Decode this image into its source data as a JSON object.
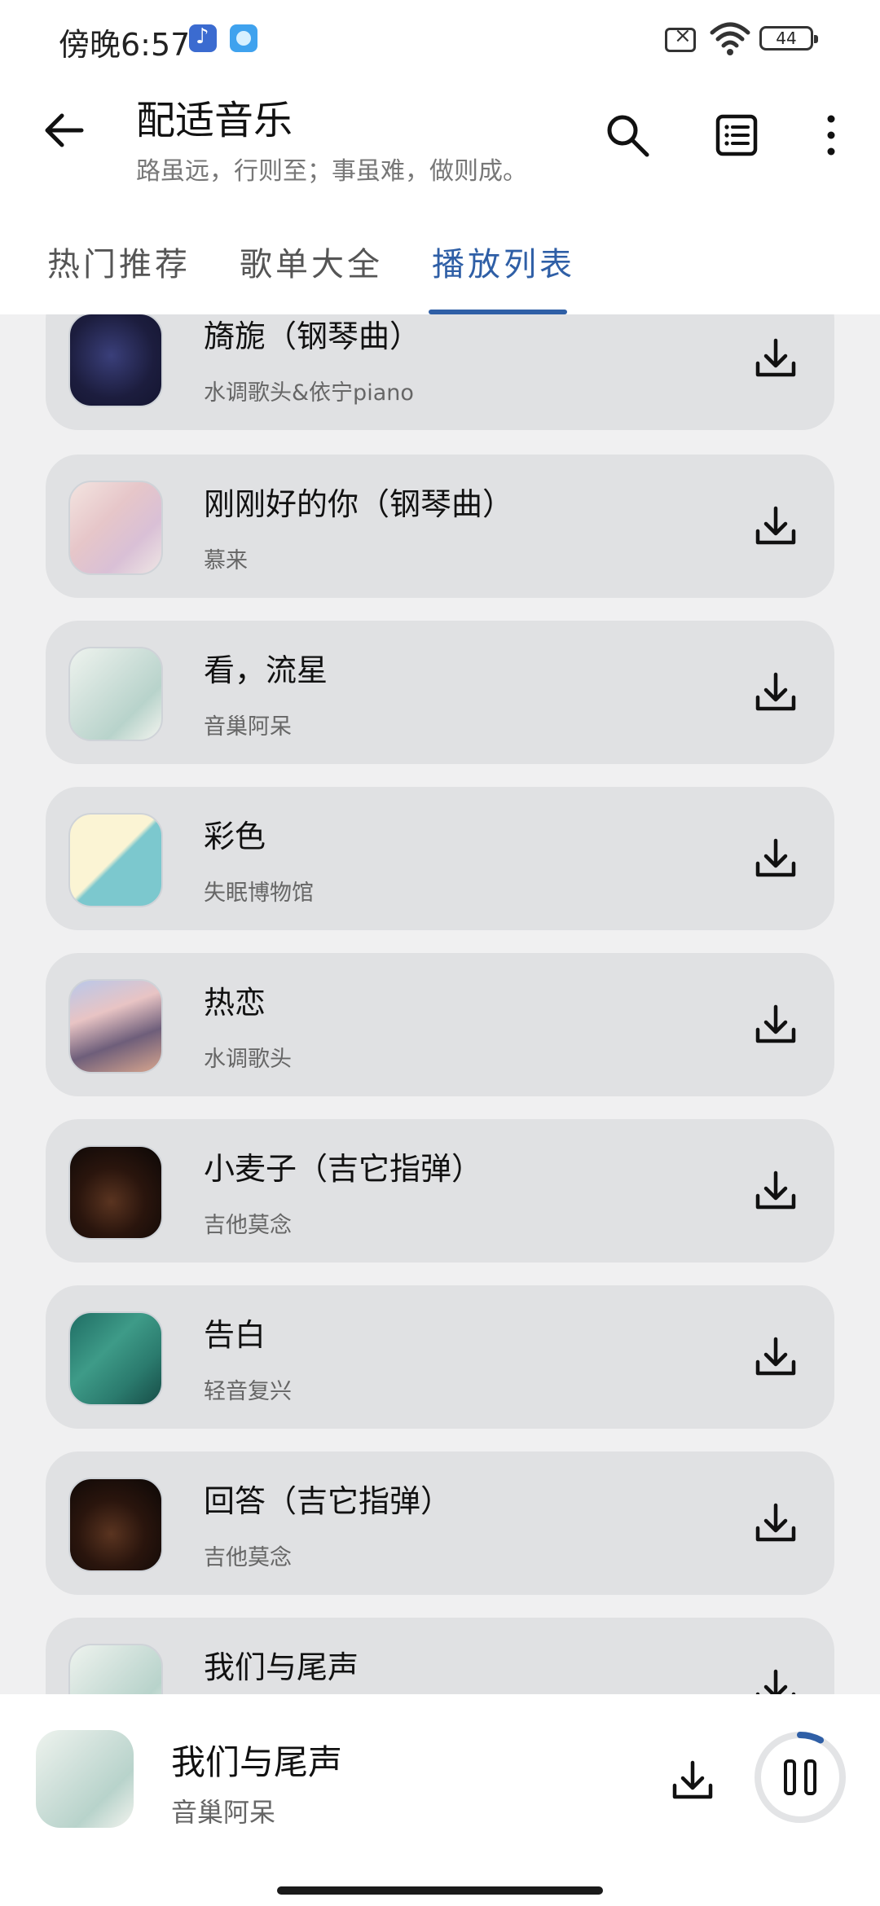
{
  "status_bar": {
    "time": "傍晚6:57",
    "battery": "44",
    "icons": [
      "music-app-icon",
      "chat-app-icon",
      "no-sim-icon",
      "wifi-icon",
      "battery-icon"
    ]
  },
  "header": {
    "title": "配适音乐",
    "subtitle": "路虽远，行则至；事虽难，做则成。",
    "icons": [
      "back-arrow-icon",
      "search-icon",
      "playlist-icon",
      "more-vertical-icon"
    ]
  },
  "tabs": [
    {
      "label": "热门推荐",
      "active": false
    },
    {
      "label": "歌单大全",
      "active": false
    },
    {
      "label": "播放列表",
      "active": true
    }
  ],
  "songs": [
    {
      "title": "旖旎（钢琴曲）",
      "artist": "水调歌头&依宁piano"
    },
    {
      "title": "刚刚好的你（钢琴曲）",
      "artist": "慕来"
    },
    {
      "title": "看，流星",
      "artist": "音巢阿呆"
    },
    {
      "title": "彩色",
      "artist": "失眠博物馆"
    },
    {
      "title": "热恋",
      "artist": "水调歌头"
    },
    {
      "title": "小麦子（吉它指弹）",
      "artist": "吉他莫念"
    },
    {
      "title": "告白",
      "artist": "轻音复兴"
    },
    {
      "title": "回答（吉它指弹）",
      "artist": "吉他莫念"
    },
    {
      "title": "我们与尾声",
      "artist": ""
    }
  ],
  "now_playing": {
    "title": "我们与尾声",
    "artist": "音巢阿呆",
    "progress": 0.08
  },
  "colors": {
    "accent": "#2f5fa6",
    "card": "#e0e1e3",
    "background": "#f0f0f1"
  }
}
